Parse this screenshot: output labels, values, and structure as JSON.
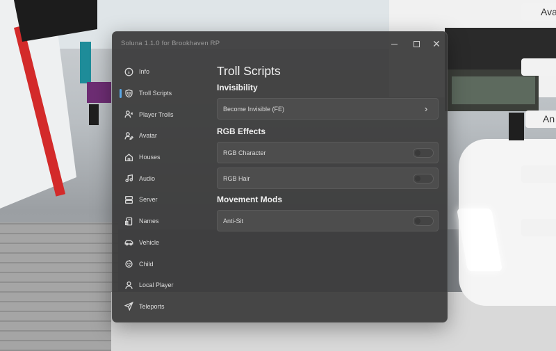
{
  "window": {
    "title": "Soluna 1.1.0 for Brookhaven RP",
    "minimize_icon": "minimize-icon",
    "maximize_icon": "maximize-icon",
    "close_icon": "close-icon",
    "close_glyph": "✕"
  },
  "sidebar": {
    "items": [
      {
        "label": "Info",
        "icon": "info-icon",
        "active": false
      },
      {
        "label": "Troll Scripts",
        "icon": "troll-icon",
        "active": true
      },
      {
        "label": "Player Trolls",
        "icon": "user-x-icon",
        "active": false
      },
      {
        "label": "Avatar",
        "icon": "user-edit-icon",
        "active": false
      },
      {
        "label": "Houses",
        "icon": "home-icon",
        "active": false
      },
      {
        "label": "Audio",
        "icon": "music-icon",
        "active": false
      },
      {
        "label": "Server",
        "icon": "server-icon",
        "active": false
      },
      {
        "label": "Names",
        "icon": "tag-icon",
        "active": false
      },
      {
        "label": "Vehicle",
        "icon": "car-icon",
        "active": false
      },
      {
        "label": "Child",
        "icon": "baby-icon",
        "active": false
      },
      {
        "label": "Local Player",
        "icon": "user-icon",
        "active": false
      },
      {
        "label": "Teleports",
        "icon": "send-icon",
        "active": false
      }
    ],
    "accent": "#5aa7e6"
  },
  "main": {
    "title": "Troll Scripts",
    "sections": [
      {
        "heading": "Invisibility",
        "rows": [
          {
            "label": "Become Invisible (FE)",
            "control": "button",
            "icon": "chevron-right-icon",
            "glyph": "›"
          }
        ]
      },
      {
        "heading": "RGB Effects",
        "rows": [
          {
            "label": "RGB Character",
            "control": "toggle",
            "state": false
          },
          {
            "label": "RGB Hair",
            "control": "toggle",
            "state": false
          }
        ]
      },
      {
        "heading": "Movement Mods",
        "rows": [
          {
            "label": "Anti-Sit",
            "control": "toggle",
            "state": false
          }
        ]
      }
    ]
  },
  "game_ui": {
    "buttons": [
      "Ava",
      "",
      "An",
      "",
      ""
    ]
  },
  "colors": {
    "window_bg": "#3a3a3a",
    "row_bg": "#4e4e4e",
    "text": "#dcdcdc",
    "accent": "#5aa7e6"
  }
}
